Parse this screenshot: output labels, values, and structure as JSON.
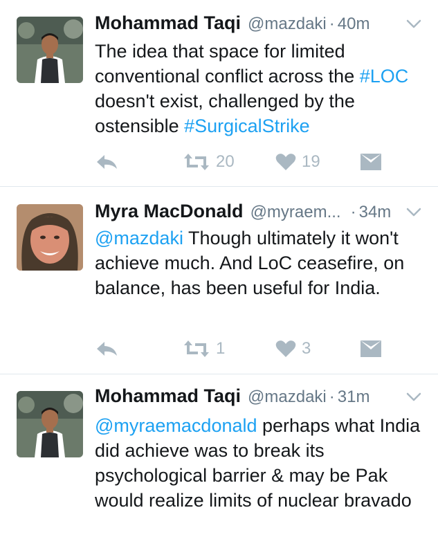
{
  "tweets": [
    {
      "name": "Mohammad Taqi",
      "handle": "@mazdaki",
      "separator": "·",
      "time": "40m",
      "text": [
        {
          "t": "The idea that space for limited conventional conflict across the "
        },
        {
          "t": "#LOC",
          "link": true
        },
        {
          "t": " doesn't exist, challenged by the ostensible "
        },
        {
          "t": "#SurgicalStrike",
          "link": true
        }
      ],
      "retweets": "20",
      "likes": "19"
    },
    {
      "name": "Myra MacDonald",
      "handle": "@myraem...",
      "separator": "·",
      "time": "34m",
      "text": [
        {
          "t": "@mazdaki",
          "link": true
        },
        {
          "t": " Though ultimately it won't achieve much. And LoC ceasefire, on balance, has been useful for India."
        }
      ],
      "retweets": "1",
      "likes": "3"
    },
    {
      "name": "Mohammad Taqi",
      "handle": "@mazdaki",
      "separator": "·",
      "time": "31m",
      "text": [
        {
          "t": "@myraemacdonald",
          "link": true
        },
        {
          "t": " perhaps what India did achieve was to break its psychological barrier & may be Pak would realize limits of nuclear bravado"
        }
      ]
    }
  ],
  "icons": {
    "reply": "reply-icon",
    "retweet": "retweet-icon",
    "like": "heart-icon",
    "dm": "envelope-icon",
    "caret": "chevron-down-icon"
  },
  "colors": {
    "link": "#1da1f2",
    "icon": "#aab8c2",
    "meta": "#657786",
    "divider": "#e1e8ed"
  }
}
